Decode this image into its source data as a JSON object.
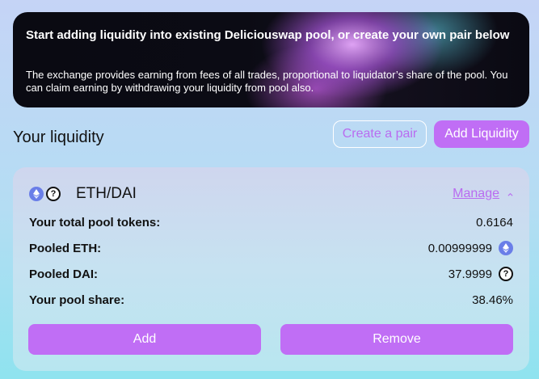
{
  "banner": {
    "title": "Start adding liquidity into existing Deliciouswap pool, or create your own pair below",
    "description": "The exchange provides earning from fees of all trades, proportional to liquidator’s share of the pool. You can claim earning by withdrawing your liquidity from pool also."
  },
  "section": {
    "title": "Your liquidity",
    "create_pair_label": "Create a pair",
    "add_liquidity_label": "Add Liquidity"
  },
  "position": {
    "pair": "ETH/DAI",
    "manage_label": "Manage",
    "rows": [
      {
        "label": "Your total pool tokens:",
        "value": "0.6164"
      },
      {
        "label": "Pooled ETH:",
        "value": "0.00999999",
        "icon": "eth-icon"
      },
      {
        "label": "Pooled DAI:",
        "value": "37.9999",
        "icon": "question-icon"
      },
      {
        "label": "Your pool share:",
        "value": "38.46%"
      }
    ],
    "add_label": "Add",
    "remove_label": "Remove"
  },
  "colors": {
    "accent": "#c06ef5",
    "accent_text": "#b96cf0",
    "eth_icon": "#6a7ee8"
  }
}
